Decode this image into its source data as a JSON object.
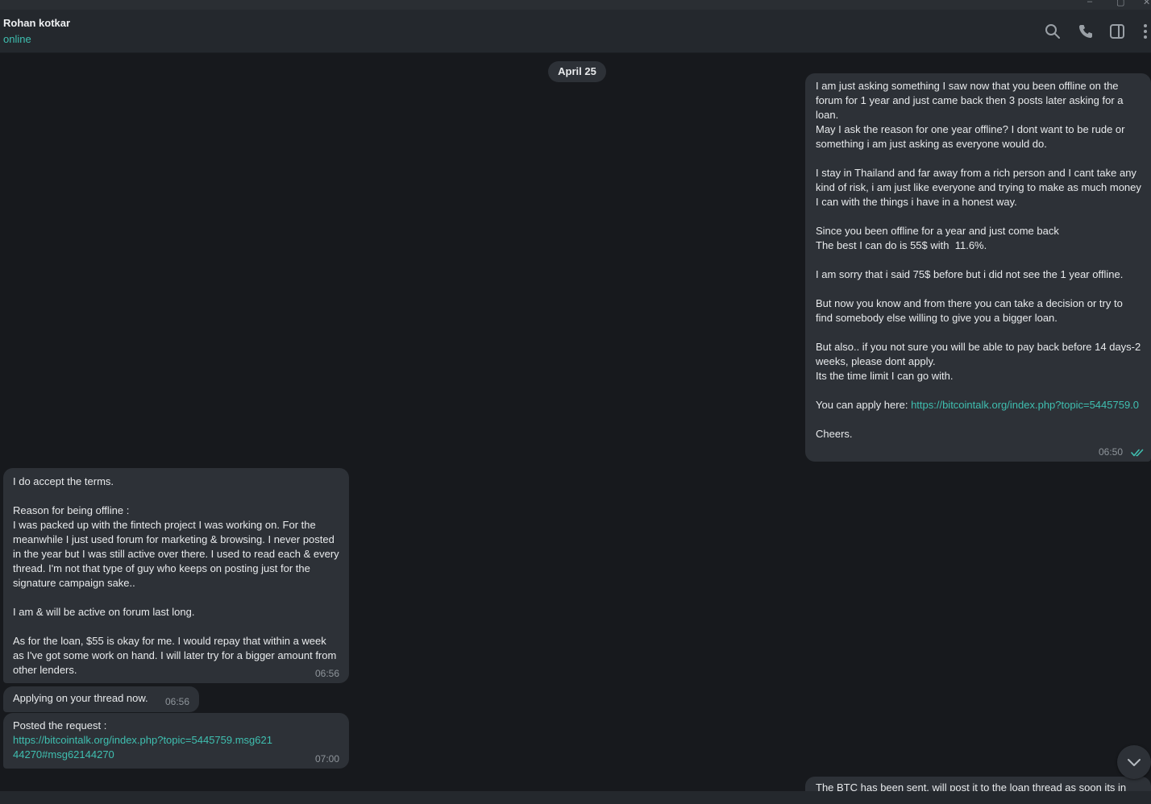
{
  "window": {
    "controls": [
      "–",
      "▢",
      "✕"
    ]
  },
  "header": {
    "peer_name": "Rohan kotkar",
    "peer_status": "online",
    "icons": [
      "search-icon",
      "phone-icon",
      "sidebar-icon",
      "more-vertical-icon"
    ]
  },
  "chat": {
    "date": "April 25",
    "messages": [
      {
        "direction": "out",
        "pre_link": "I am just asking something I saw now that you been offline on the forum for 1 year and just came back then 3 posts later asking for a loan.\nMay I ask the reason for one year offline? I dont want to be rude or something i am just asking as everyone would do.\n\nI stay in Thailand and far away from a rich person and I cant take any kind of risk, i am just like everyone and trying to make as much money I can with the things i have in a honest way.\n\nSince you been offline for a year and just come back\nThe best I can do is 55$ with  11.6%.\n\nI am sorry that i said 75$ before but i did not see the 1 year offline.\n\nBut now you know and from there you can take a decision or try to find somebody else willing to give you a bigger loan.\n\nBut also.. if you not sure you will be able to pay back before 14 days-2 weeks, please dont apply.\nIts the time limit I can go with.\n\nYou can apply here: ",
        "link": "https://bitcointalk.org/index.php?topic=5445759.0",
        "post_link": "\n\nCheers.",
        "time": "06:50",
        "status": "read"
      },
      {
        "direction": "in",
        "text": "I do accept the terms.\n\nReason for being offline :\nI was packed up with the fintech project I was working on. For the meanwhile I just used forum for marketing & browsing. I never posted in the year but I was still active over there. I used to read each & every thread. I'm not that type of guy who keeps on posting just for the signature campaign sake..\n\nI am & will be active on forum last long.\n\nAs for the loan, $55 is okay for me. I would repay that within a week as I've got some work on hand. I will later try for a bigger amount from other lenders.",
        "time": "06:56"
      },
      {
        "direction": "in",
        "text": "Applying on your thread now.",
        "time": "06:56"
      },
      {
        "direction": "in",
        "pre_link": "Posted the request :\n",
        "link": "https://bitcointalk.org/index.php?topic=5445759.msg62144270#msg62144270",
        "time": "07:00"
      },
      {
        "direction": "out",
        "text": "The BTC has been sent, will post it to the loan thread as soon its in"
      }
    ]
  },
  "scroll_button": {
    "icon": "chevron-down-icon"
  },
  "colors": {
    "background": "#17191d",
    "header": "#24282d",
    "bubble": "#2d3137",
    "accent": "#3fbfb0"
  }
}
